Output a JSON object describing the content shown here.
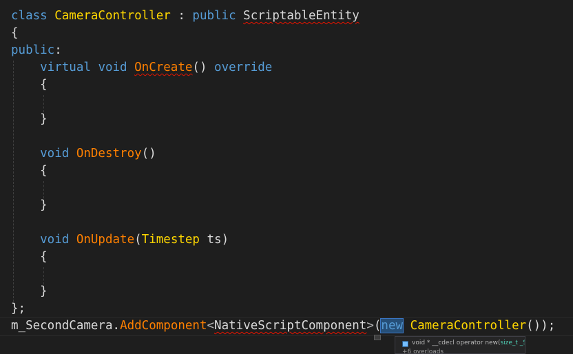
{
  "editor": {
    "lines": [
      {
        "tokens": [
          {
            "text": "class ",
            "kind": "kw"
          },
          {
            "text": "CameraController",
            "kind": "ty"
          },
          {
            "text": " : ",
            "kind": "pn"
          },
          {
            "text": "public ",
            "kind": "kw"
          },
          {
            "text": "ScriptableEntity",
            "kind": "id",
            "squiggle": true
          }
        ]
      },
      {
        "tokens": [
          {
            "text": "{",
            "kind": "pn"
          }
        ]
      },
      {
        "tokens": [
          {
            "text": "public",
            "kind": "kw"
          },
          {
            "text": ":",
            "kind": "pn"
          }
        ]
      },
      {
        "tokens": [
          {
            "text": "    virtual ",
            "kind": "kw"
          },
          {
            "text": "void ",
            "kind": "kw"
          },
          {
            "text": "OnCreate",
            "kind": "fn",
            "squiggle": true
          },
          {
            "text": "() ",
            "kind": "pn"
          },
          {
            "text": "override",
            "kind": "kw"
          }
        ]
      },
      {
        "tokens": [
          {
            "text": "    {",
            "kind": "pn"
          }
        ]
      },
      {
        "tokens": []
      },
      {
        "tokens": [
          {
            "text": "    }",
            "kind": "pn"
          }
        ]
      },
      {
        "tokens": []
      },
      {
        "tokens": [
          {
            "text": "    void ",
            "kind": "kw"
          },
          {
            "text": "OnDestroy",
            "kind": "fn"
          },
          {
            "text": "()",
            "kind": "pn"
          }
        ]
      },
      {
        "tokens": [
          {
            "text": "    {",
            "kind": "pn"
          }
        ]
      },
      {
        "tokens": []
      },
      {
        "tokens": [
          {
            "text": "    }",
            "kind": "pn"
          }
        ]
      },
      {
        "tokens": []
      },
      {
        "tokens": [
          {
            "text": "    void ",
            "kind": "kw"
          },
          {
            "text": "OnUpdate",
            "kind": "fn"
          },
          {
            "text": "(",
            "kind": "pn"
          },
          {
            "text": "Timestep",
            "kind": "ty"
          },
          {
            "text": " ts",
            "kind": "id"
          },
          {
            "text": ")",
            "kind": "pn"
          }
        ]
      },
      {
        "tokens": [
          {
            "text": "    {",
            "kind": "pn"
          }
        ]
      },
      {
        "tokens": []
      },
      {
        "tokens": [
          {
            "text": "    }",
            "kind": "pn"
          }
        ]
      },
      {
        "tokens": [
          {
            "text": "};",
            "kind": "pn"
          }
        ]
      },
      {
        "tokens": [
          {
            "text": "m_SecondCamera",
            "kind": "id"
          },
          {
            "text": ".",
            "kind": "pn"
          },
          {
            "text": "AddComponent",
            "kind": "fn"
          },
          {
            "text": "<",
            "kind": "op"
          },
          {
            "text": "NativeScriptComponent",
            "kind": "id",
            "squiggle": true
          },
          {
            "text": ">",
            "kind": "op"
          },
          {
            "text": "(",
            "kind": "pn"
          },
          {
            "text": "new",
            "kind": "kw",
            "selected": true
          },
          {
            "text": " ",
            "kind": "pn"
          },
          {
            "text": "CameraController",
            "kind": "ty"
          },
          {
            "text": "());",
            "kind": "pn"
          }
        ]
      }
    ]
  },
  "tooltip": {
    "icon": "method-icon",
    "signature_prefix": "void * __cdecl operator new(",
    "signature_param": "size_t _Size",
    "signature_suffix": ")",
    "overloads": "+6 overloads"
  },
  "lightbulb": {
    "icon": "quick-actions-icon"
  }
}
